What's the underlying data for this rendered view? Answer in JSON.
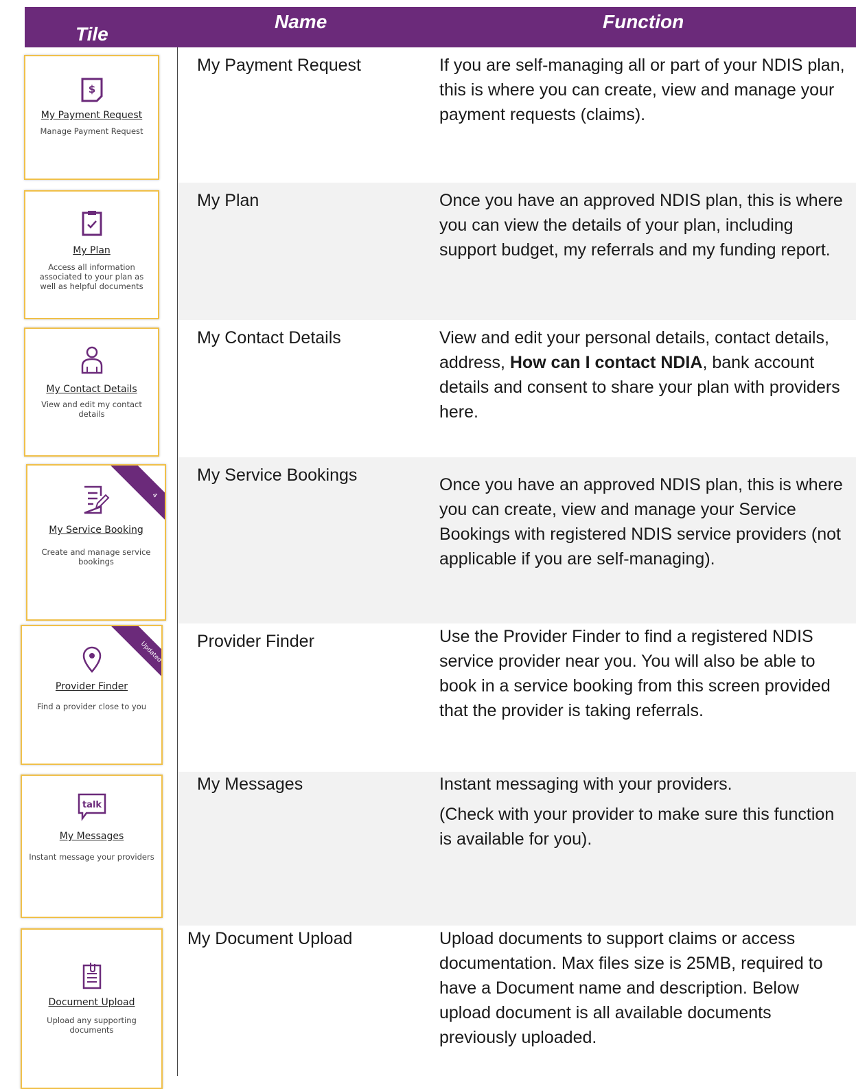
{
  "header": {
    "tile": "Tile",
    "name": "Name",
    "function": "Function"
  },
  "colors": {
    "header_bg": "#6b2a7a",
    "tile_border": "#f0c04a",
    "row_shade": "#f2f2f2"
  },
  "rows": [
    {
      "name": "My Payment Request",
      "tile": {
        "icon": "payment-document-icon",
        "title": "My Payment Request",
        "desc": "Manage Payment Request"
      },
      "func": [
        "If you are self-managing all or part of your NDIS plan, this is where you can create, view and manage your payment requests (claims)."
      ]
    },
    {
      "name": "My Plan",
      "tile": {
        "icon": "clipboard-check-icon",
        "title": "My Plan",
        "desc": "Access all information associated to your plan as well as helpful documents"
      },
      "func": [
        "Once you have an approved NDIS plan, this is where you can view the details of your plan, including support budget, my referrals and my funding report."
      ]
    },
    {
      "name": "My Contact Details",
      "tile": {
        "icon": "person-icon",
        "title": "My Contact Details",
        "desc": "View and edit my contact details"
      },
      "func_pre": "View and edit your personal details, contact details, address, ",
      "func_bold": "How can I contact NDIA",
      "func_post": ", bank account details and consent to share your plan with providers here."
    },
    {
      "name": "My Service Bookings",
      "tile": {
        "icon": "edit-document-icon",
        "title": "My Service Booking",
        "desc": "Create and manage service bookings",
        "ribbon": "4"
      },
      "func": [
        "Once you have an approved NDIS plan, this is where you can create, view and manage your Service Bookings with registered NDIS service providers (not applicable if you are self-managing)."
      ]
    },
    {
      "name": "Provider Finder",
      "tile": {
        "icon": "location-pin-icon",
        "title": "Provider Finder",
        "desc": "Find a provider close to you",
        "ribbon": "Updated"
      },
      "func": [
        "Use the Provider Finder to find a registered NDIS service provider near you. You will also be able to book in a service booking from this screen provided that the provider is taking referrals."
      ]
    },
    {
      "name": "My Messages",
      "tile": {
        "icon": "talk-bubble-icon",
        "icon_text": "talk",
        "title": "My Messages",
        "desc": "Instant message your providers"
      },
      "func": [
        "Instant messaging with your providers.",
        "(Check with your provider to make sure this function is available for you)."
      ]
    },
    {
      "name": "My Document Upload",
      "tile": {
        "icon": "document-clip-icon",
        "title": "Document Upload",
        "desc": "Upload any supporting documents"
      },
      "func": [
        "Upload documents to support claims or access documentation. Max files size is 25MB, required to have a Document name and description. Below upload document is all available documents previously uploaded."
      ]
    }
  ]
}
